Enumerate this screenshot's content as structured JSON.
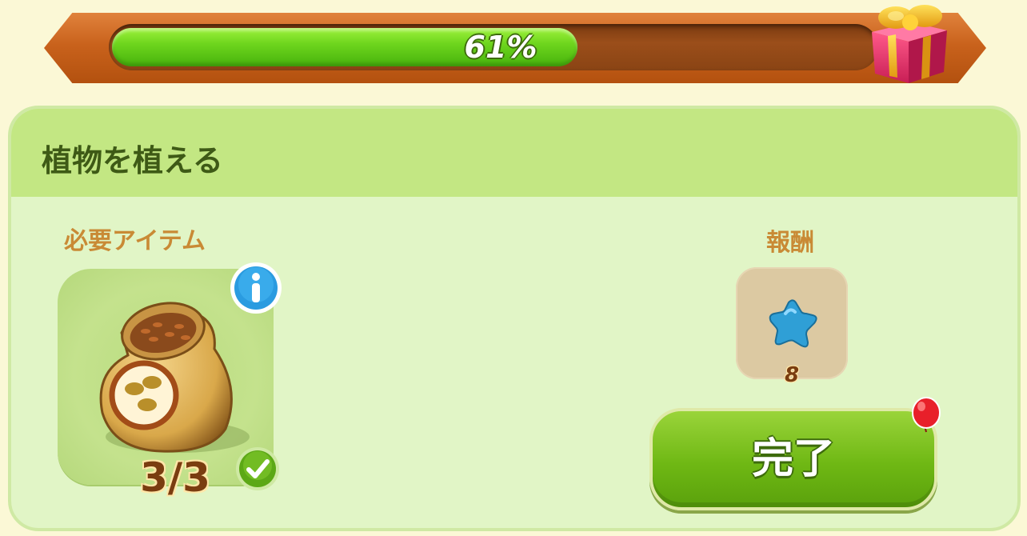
{
  "progress": {
    "value": 0.61,
    "label": "61%"
  },
  "task": {
    "title": "植物を植える",
    "required_label": "必要アイテム",
    "reward_label": "報酬",
    "required_item": {
      "icon": "seed-bag-icon",
      "count": "3/3",
      "status": "complete"
    },
    "reward": {
      "icon": "blue-star-icon",
      "amount": "8"
    },
    "complete_button_label": "完了"
  },
  "colors": {
    "progress_fill": "#6fd61e",
    "card_bg": "#e1f5c6",
    "header_bg": "#c3e783",
    "label_color": "#c98a35",
    "button_green": "#6fb814",
    "notification_red": "#e8202a"
  }
}
